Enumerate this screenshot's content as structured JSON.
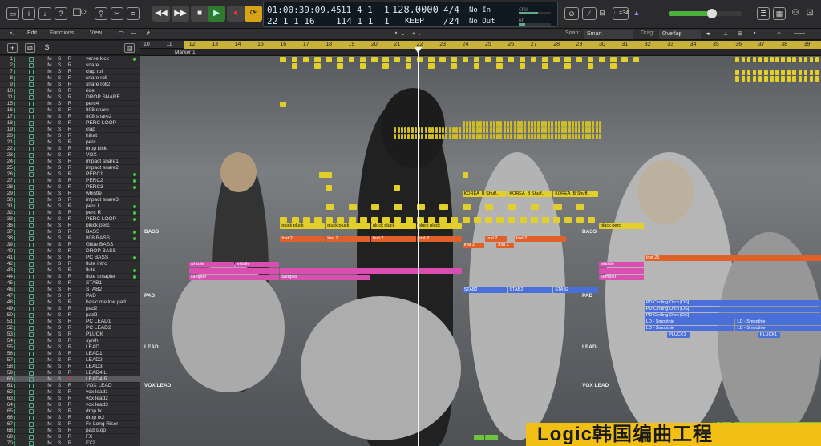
{
  "control_bar": {
    "lcd": {
      "time": "01:00:39:09.45",
      "bars": "11  4  1",
      "beat_div": "1",
      "tempo": "128.0000",
      "signature": "4/4",
      "midi_in": "No In",
      "sub_position": "22  1  1   16",
      "bars2": "114  1  1",
      "tick": "1",
      "keep": "KEEP",
      "division": "/24",
      "midi_out": "No Out",
      "cpu_label": "CPU",
      "hd_label": "HD"
    },
    "count_in": "1234",
    "key_badge": "♩=34",
    "transport": [
      "rewind",
      "forward",
      "stop",
      "play",
      "record",
      "cycle"
    ]
  },
  "edit_toolbar": {
    "edit": "Edit",
    "functions": "Functions",
    "view": "View",
    "snap_label": "Snap:",
    "snap_value": "Smart",
    "drag_label": "Drag:",
    "drag_value": "Overlap"
  },
  "track_header": {
    "add": "+",
    "s_button": "S"
  },
  "ruler": {
    "bars": [
      "10",
      "11",
      "12",
      "13",
      "14",
      "15",
      "16",
      "17",
      "18",
      "19",
      "20",
      "21",
      "22",
      "23",
      "24",
      "25",
      "26",
      "27",
      "28",
      "29",
      "30",
      "31",
      "32",
      "33",
      "34",
      "35",
      "36",
      "37",
      "38",
      "39"
    ],
    "marker": "Marker 1"
  },
  "tracks": [
    {
      "n": "1",
      "name": "verse kick",
      "dot": true
    },
    {
      "n": "2",
      "name": "snare"
    },
    {
      "n": "7",
      "name": "clap roll"
    },
    {
      "n": "8",
      "name": "snare roll"
    },
    {
      "n": "9",
      "name": "snare roll2"
    },
    {
      "n": "10",
      "name": "ride"
    },
    {
      "n": "11",
      "name": "DROP SNARE"
    },
    {
      "n": "15",
      "name": "perc4"
    },
    {
      "n": "16",
      "name": "808 snare"
    },
    {
      "n": "17",
      "name": "808 snare2"
    },
    {
      "n": "18",
      "name": "PERC LOOP"
    },
    {
      "n": "19",
      "name": "clap"
    },
    {
      "n": "20",
      "name": "hihat"
    },
    {
      "n": "21",
      "name": "perc"
    },
    {
      "n": "22",
      "name": "drop kick"
    },
    {
      "n": "23",
      "name": "VOX"
    },
    {
      "n": "24",
      "name": "impact snare1"
    },
    {
      "n": "25",
      "name": "impact snare2"
    },
    {
      "n": "26",
      "name": "PERC1",
      "dot": true
    },
    {
      "n": "27",
      "name": "PERC2",
      "dot": true
    },
    {
      "n": "28",
      "name": "PERC3",
      "dot": true
    },
    {
      "n": "29",
      "name": "whistle"
    },
    {
      "n": "30",
      "name": "impact snare3"
    },
    {
      "n": "31",
      "name": "perc L",
      "dot": true
    },
    {
      "n": "32",
      "name": "perc R",
      "dot": true
    },
    {
      "n": "33",
      "name": "PERC LOOP",
      "dot": true
    },
    {
      "n": "36",
      "name": "pluck perc"
    },
    {
      "n": "37",
      "name": "BASS",
      "dot": true
    },
    {
      "n": "38",
      "name": "808 BASS",
      "dot": true
    },
    {
      "n": "39",
      "name": "Glide BASS"
    },
    {
      "n": "40",
      "name": "DROP BASS"
    },
    {
      "n": "41",
      "name": "PC BASS",
      "dot": true
    },
    {
      "n": "42",
      "name": "flute intro"
    },
    {
      "n": "43",
      "name": "flute",
      "dot": true
    },
    {
      "n": "44",
      "name": "flute smapler",
      "dot": true
    },
    {
      "n": "45",
      "name": "STAB1"
    },
    {
      "n": "46",
      "name": "STAB2"
    },
    {
      "n": "47",
      "name": "PAD"
    },
    {
      "n": "48",
      "name": "basic mellow pad"
    },
    {
      "n": "49",
      "name": "pad2"
    },
    {
      "n": "50",
      "name": "pad2"
    },
    {
      "n": "51",
      "name": "PC LEAD1"
    },
    {
      "n": "52",
      "name": "PC LEAD2"
    },
    {
      "n": "53",
      "name": "PLUCK"
    },
    {
      "n": "54",
      "name": "synth"
    },
    {
      "n": "55",
      "name": "LEAD"
    },
    {
      "n": "56",
      "name": "LEAD1"
    },
    {
      "n": "57",
      "name": "LEAD2"
    },
    {
      "n": "58",
      "name": "LEAD3"
    },
    {
      "n": "59",
      "name": "LEAD4 L"
    },
    {
      "n": "60",
      "name": "LEAD4 R",
      "rec": true,
      "sel": true
    },
    {
      "n": "61",
      "name": "VOX LEAD"
    },
    {
      "n": "62",
      "name": "vox lead1"
    },
    {
      "n": "63",
      "name": "vox lead2"
    },
    {
      "n": "64",
      "name": "vox lead3"
    },
    {
      "n": "65",
      "name": "drop fx"
    },
    {
      "n": "66",
      "name": "drop fx2"
    },
    {
      "n": "67",
      "name": "Fx Long Riser"
    },
    {
      "n": "68",
      "name": "pad stop"
    },
    {
      "n": "69",
      "name": "FX"
    },
    {
      "n": "70",
      "name": "FX2"
    }
  ],
  "track_flags": {
    "m": "M",
    "s": "S",
    "r": "R"
  },
  "arrange": {
    "folder_labels": {
      "bass": "BASS",
      "pad": "PAD",
      "lead": "LEAD",
      "vox_lead": "VOX LEAD"
    },
    "regions": {
      "pluck": "pluck pluck",
      "pluck_perc": "pluck perc",
      "inst2": "Inst 2",
      "inst25": "Inst 25",
      "whistle": "whistle",
      "sampler": "sampler",
      "stab2": "STAB2",
      "pd_orch": "PD Circling Orch [OS]",
      "ld_smoothie": "LD - Smoothie",
      "pluck1": "PLUCK1",
      "fx_riser": "Fx Long Riser",
      "korea": "KOREA_B Shuff.."
    }
  },
  "banner": "Logic韩国编曲工程",
  "colors": {
    "cycle": "#c9b23a",
    "yellow": "#e3cf2a",
    "orange": "#e0602a",
    "pink": "#d94eb0",
    "blue": "#4a6fd8",
    "green": "#6ec43c",
    "banner": "#f2c014"
  }
}
